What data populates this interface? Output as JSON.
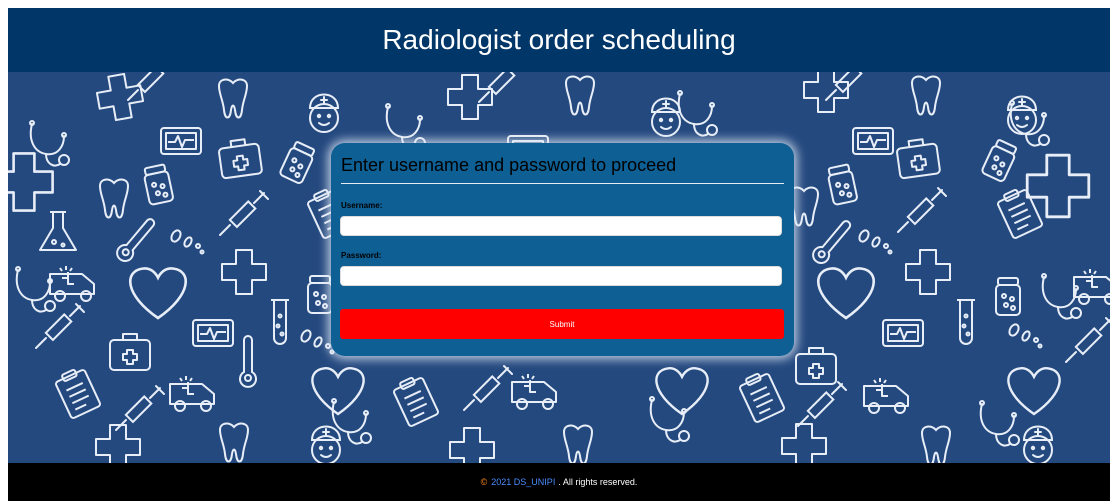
{
  "header": {
    "title": "Radiologist order scheduling"
  },
  "login": {
    "heading": "Enter username and password to proceed",
    "username_label": "Username:",
    "username_value": "",
    "password_label": "Password:",
    "password_value": "",
    "submit_label": "Submit"
  },
  "footer": {
    "copyright_symbol": "©",
    "year_org": "2021 DS_UNIPI",
    "rights": ". All rights reserved."
  },
  "colors": {
    "header_bg": "#013668",
    "pattern_bg": "#24497f",
    "card_bg": "#0d5f94",
    "submit_bg": "#ff0000",
    "footer_bg": "#000000",
    "footer_link": "#4a8dff"
  },
  "background_icons": [
    "cross-icon",
    "tooth-icon",
    "stethoscope-icon",
    "nurse-icon",
    "syringe-icon",
    "heart-monitor-icon",
    "pill-bottle-icon",
    "flask-icon",
    "ambulance-icon",
    "heart-icon",
    "clipboard-icon",
    "thermometer-icon",
    "test-tube-icon",
    "medical-bag-icon",
    "pills-icon"
  ]
}
